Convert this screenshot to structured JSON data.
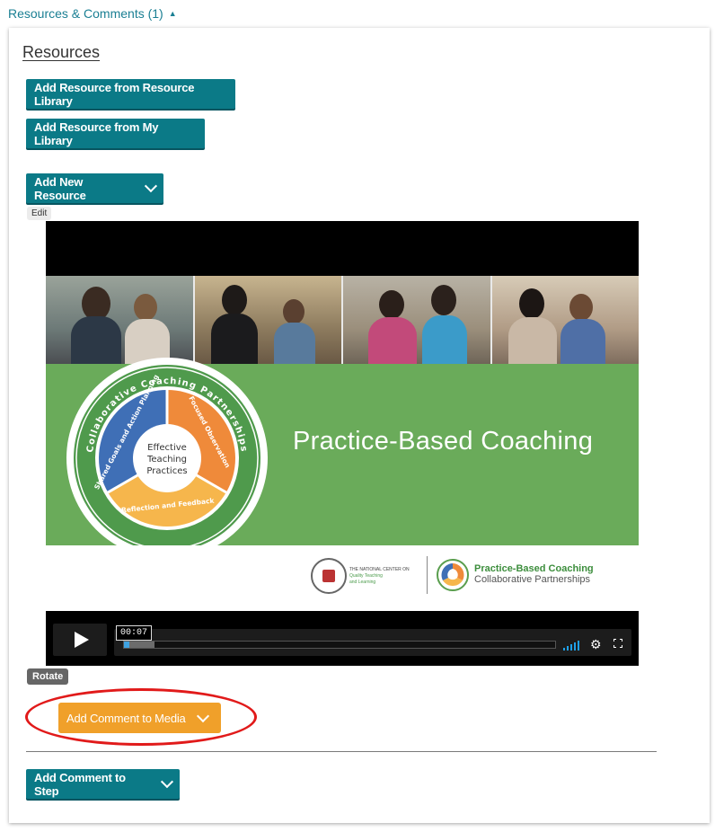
{
  "section": {
    "toggle_label": "Resources & Comments (1)",
    "toggle_caret": "▲"
  },
  "resources": {
    "title": "Resources",
    "add_from_resource_library": "Add Resource from Resource Library",
    "add_from_my_library": "Add Resource from My Library",
    "add_new_resource": "Add New Resource"
  },
  "media": {
    "edit_label": "Edit",
    "rotate_label": "Rotate",
    "slide_title": "Practice-Based Coaching",
    "wheel_outer_text": "Collaborative Coaching Partnerships",
    "wheel_segments": [
      "Shared Goals and Action Planning",
      "Focused Observation",
      "Reflection and Feedback"
    ],
    "wheel_center": [
      "Effective",
      "Teaching",
      "Practices"
    ],
    "footer_org_lines": [
      "THE NATIONAL CENTER ON",
      "Quality Teaching",
      "and Learning"
    ],
    "footer_brand_line1": "Practice-Based Coaching",
    "footer_brand_line2": "Collaborative Partnerships",
    "player": {
      "timestamp": "00:07",
      "progress_fraction": 0.07
    },
    "colors": {
      "slide_green": "#6aab5a",
      "wheel_blue": "#3f6fb6",
      "wheel_orange": "#ef8a3a",
      "wheel_yellow": "#f6b64c"
    }
  },
  "comments": {
    "add_comment_to_media": "Add Comment to Media",
    "add_comment_to_step": "Add Comment to Step"
  },
  "colors": {
    "teal_button": "#0b7a87",
    "orange_button": "#f0a02a",
    "highlight_ring": "#e11a1a",
    "link": "#1a7f93"
  }
}
